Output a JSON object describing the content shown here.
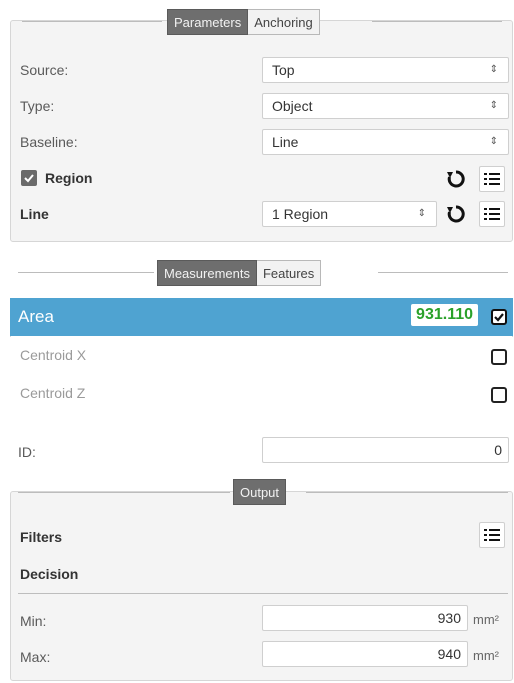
{
  "parameters": {
    "tabs": {
      "active": "Parameters",
      "inactive": "Anchoring"
    },
    "source": {
      "label": "Source:",
      "value": "Top"
    },
    "type": {
      "label": "Type:",
      "value": "Object"
    },
    "baseline": {
      "label": "Baseline:",
      "value": "Line"
    },
    "region": {
      "label": "Region",
      "checked": true
    },
    "line": {
      "label": "Line",
      "value": "1 Region"
    }
  },
  "measurements": {
    "tabs": {
      "active": "Measurements",
      "inactive": "Features"
    },
    "items": [
      {
        "label": "Area",
        "value": "931.110",
        "checked": true,
        "selected": true
      },
      {
        "label": "Centroid X",
        "checked": false,
        "selected": false
      },
      {
        "label": "Centroid Z",
        "checked": false,
        "selected": false
      }
    ]
  },
  "id": {
    "label": "ID:",
    "value": "0"
  },
  "output": {
    "tab": "Output",
    "filters_label": "Filters",
    "decision_label": "Decision",
    "min": {
      "label": "Min:",
      "value": "930",
      "unit": "mm²"
    },
    "max": {
      "label": "Max:",
      "value": "940",
      "unit": "mm²"
    }
  },
  "colors": {
    "selected_row": "#4fa3d1",
    "value_badge_text": "#2aa12a",
    "active_tab": "#6e6e6e"
  },
  "icons": [
    "check-icon",
    "reset-icon",
    "list-icon",
    "select-arrows-icon",
    "checkbox-icon"
  ]
}
